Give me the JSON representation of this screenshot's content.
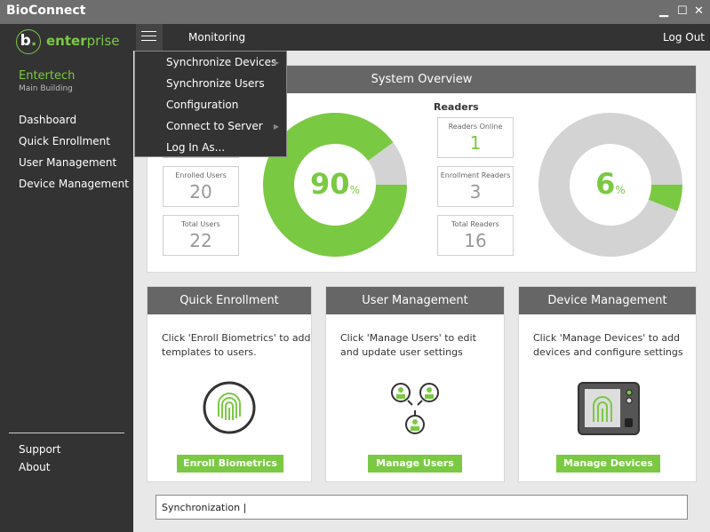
{
  "window": {
    "title": "BioConnect"
  },
  "logo": {
    "text_bold": "enter",
    "text_light": "prise"
  },
  "site": {
    "name": "Entertech",
    "building": "Main Building"
  },
  "sidebar": {
    "items": [
      "Dashboard",
      "Quick Enrollment",
      "User Management",
      "Device Management"
    ],
    "footer": [
      "Support",
      "About"
    ]
  },
  "topbar": {
    "title": "Monitoring",
    "logout": "Log Out"
  },
  "menu": {
    "items": [
      {
        "label": "Synchronize Devices",
        "submenu": true
      },
      {
        "label": "Synchronize Users"
      },
      {
        "label": "Configuration"
      },
      {
        "label": "Connect to Server",
        "submenu": true
      },
      {
        "label": "Log In As..."
      }
    ]
  },
  "overview": {
    "title": "System Overview",
    "readers_label": "Readers",
    "users": [
      {
        "label": "Enrolled Users",
        "value": "20"
      },
      {
        "label": "Total Users",
        "value": "22"
      }
    ],
    "readers": [
      {
        "label": "Readers Online",
        "value": "1"
      },
      {
        "label": "Enrollment Readers",
        "value": "3"
      },
      {
        "label": "Total Readers",
        "value": "16"
      }
    ],
    "donut_users": {
      "value": 90,
      "label": "90",
      "unit": "%"
    },
    "donut_readers": {
      "value": 6,
      "label": "6",
      "unit": "%"
    }
  },
  "cards": [
    {
      "title": "Quick Enrollment",
      "desc": "Click 'Enroll Biometrics' to add templates to users.",
      "button": "Enroll Biometrics"
    },
    {
      "title": "User Management",
      "desc": "Click 'Manage Users' to edit and update user settings",
      "button": "Manage Users"
    },
    {
      "title": "Device Management",
      "desc": "Click 'Manage Devices' to add devices and configure settings",
      "button": "Manage Devices"
    }
  ],
  "search": {
    "value": "Synchronization"
  },
  "colors": {
    "accent": "#7ac943",
    "gray": "#d3d3d3"
  }
}
